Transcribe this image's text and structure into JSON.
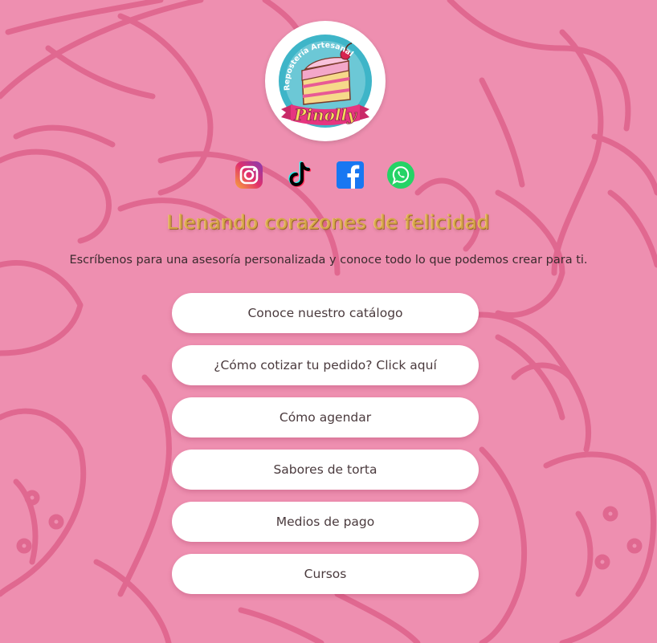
{
  "logo": {
    "arc_text": "Repostería Artesanal",
    "brand": "Pinolly",
    "colors": {
      "ring": "#3eb5c8",
      "ribbon": "#e6357f",
      "brand_text": "#f5dd5a"
    }
  },
  "socials": [
    {
      "name": "instagram-icon",
      "color": "#d6297f"
    },
    {
      "name": "tiktok-icon",
      "color": "#000000"
    },
    {
      "name": "facebook-icon",
      "color": "#1877f2"
    },
    {
      "name": "whatsapp-icon",
      "color": "#25d366"
    }
  ],
  "tagline": "Llenando corazones de felicidad",
  "intro": "Escríbenos para una asesoría personalizada y conoce todo lo que podemos crear para ti.",
  "links": [
    {
      "label": "Conoce nuestro catálogo"
    },
    {
      "label": "¿Cómo cotizar tu pedido? Click aquí"
    },
    {
      "label": "Cómo agendar"
    },
    {
      "label": "Sabores de torta"
    },
    {
      "label": "Medios de pago"
    },
    {
      "label": "Cursos"
    }
  ],
  "colors": {
    "background": "#ee8fb0",
    "doodle_lines": "#d9507d",
    "button_bg": "#ffffff",
    "tagline": "#d6a64a"
  }
}
